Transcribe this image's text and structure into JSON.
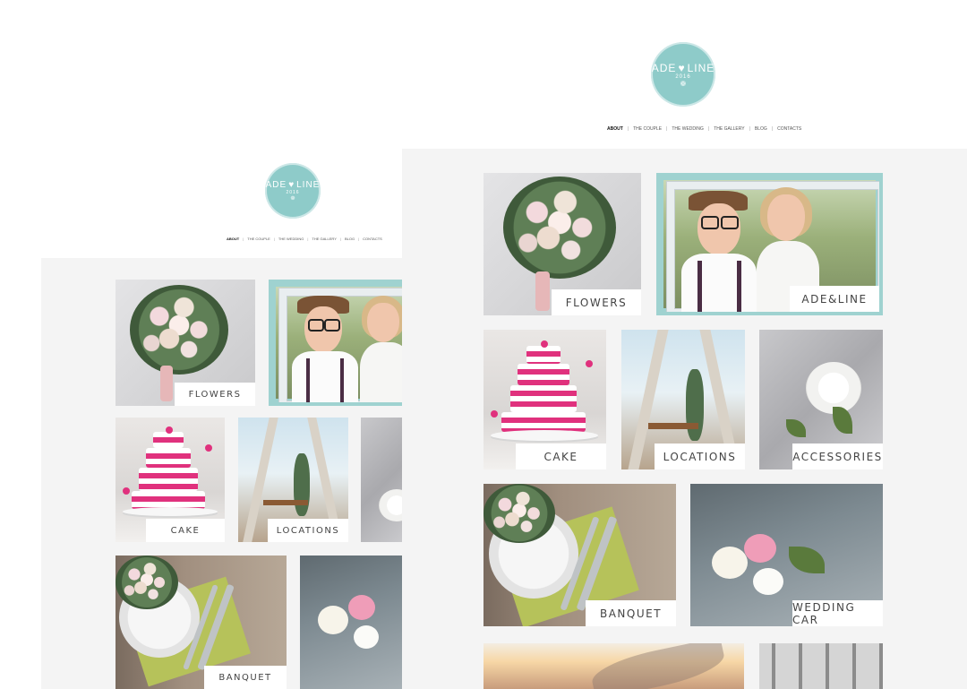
{
  "brand": {
    "name_left": "ADE",
    "name_right": "LINE",
    "year": "2016",
    "heart_icon": "heart-icon",
    "birds_icon": "birds-icon",
    "accent": "#8ecbc9"
  },
  "nav": {
    "items": [
      {
        "label": "ABOUT",
        "active": true
      },
      {
        "label": "THE COUPLE"
      },
      {
        "label": "THE WEDDING"
      },
      {
        "label": "THE GALLERY"
      },
      {
        "label": "BLOG"
      },
      {
        "label": "CONTACTS"
      }
    ],
    "separator": "|"
  },
  "tiles": {
    "flowers": "FLOWERS",
    "adeline": "ADE&LINE",
    "cake": "CAKE",
    "locations": "LOCATIONS",
    "accessories": "ACCESSORIES",
    "banquet": "BANQUET",
    "wedding_car": "WEDDING CAR"
  }
}
